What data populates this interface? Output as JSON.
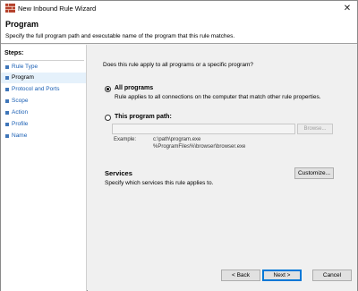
{
  "window": {
    "title": "New Inbound Rule Wizard"
  },
  "header": {
    "title": "Program",
    "description": "Specify the full program path and executable name of the program that this rule matches."
  },
  "steps": {
    "label": "Steps:",
    "items": [
      {
        "label": "Rule Type",
        "active": false
      },
      {
        "label": "Program",
        "active": true
      },
      {
        "label": "Protocol and Ports",
        "active": false
      },
      {
        "label": "Scope",
        "active": false
      },
      {
        "label": "Action",
        "active": false
      },
      {
        "label": "Profile",
        "active": false
      },
      {
        "label": "Name",
        "active": false
      }
    ]
  },
  "main": {
    "question": "Does this rule apply to all programs or a specific program?",
    "all_programs": {
      "label": "All programs",
      "description": "Rule applies to all connections on the computer that match other rule properties.",
      "checked": true
    },
    "program_path": {
      "label": "This program path:",
      "value": "",
      "checked": false,
      "browse_label": "Browse..."
    },
    "example": {
      "label": "Example:",
      "lines": [
        "c:\\path\\program.exe",
        "%ProgramFiles%\\browser\\browser.exe"
      ]
    },
    "services": {
      "title": "Services",
      "description": "Specify which services this rule applies to.",
      "customize_label": "Customize..."
    }
  },
  "footer": {
    "back_label": "< Back",
    "next_label": "Next >",
    "cancel_label": "Cancel"
  },
  "colors": {
    "accent": "#0078d7",
    "step_link": "#1a5fb4",
    "step_bullet": "#3f76b9",
    "active_step_bg": "#e5f1fb"
  }
}
